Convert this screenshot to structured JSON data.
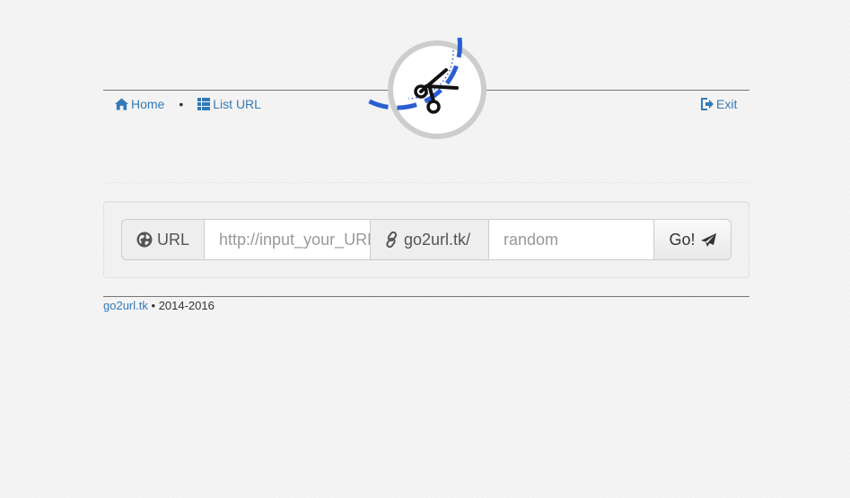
{
  "nav": {
    "home_label": "Home",
    "separator": "•",
    "list_label": "List URL",
    "exit_label": "Exit"
  },
  "shortener": {
    "url_addon_label": "URL",
    "url_placeholder": "http://input_your_URL",
    "domain_addon_label": "go2url.tk/",
    "alias_placeholder": "random",
    "go_label": "Go!"
  },
  "footer": {
    "site_link": "go2url.tk",
    "separator": "•",
    "years": "2014-2016"
  },
  "colors": {
    "link": "#337ab7",
    "logo_accent": "#2a5fd0",
    "logo_ring": "#cccccc"
  },
  "icons": {
    "home": "home-icon",
    "list": "list-icon",
    "exit": "exit-icon",
    "url": "globe-icon",
    "domain": "link-icon",
    "go": "send-icon",
    "logo": "scissors-icon"
  }
}
